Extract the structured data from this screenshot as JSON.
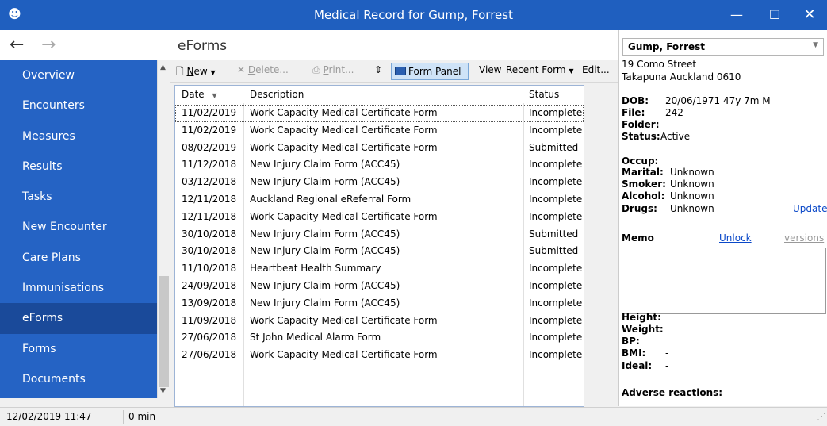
{
  "window": {
    "title": "Medical Record for Gump, Forrest",
    "minimize": "—",
    "maximize": "☐",
    "close": "✕",
    "app_icon": "☻"
  },
  "nav": {
    "back": "←",
    "forward": "→"
  },
  "sidebar": {
    "items": [
      {
        "label": "Overview"
      },
      {
        "label": "Encounters"
      },
      {
        "label": "Measures"
      },
      {
        "label": "Results"
      },
      {
        "label": "Tasks"
      },
      {
        "label": "New Encounter"
      },
      {
        "label": "Care Plans"
      },
      {
        "label": "Immunisations"
      },
      {
        "label": "eForms"
      },
      {
        "label": "Forms"
      },
      {
        "label": "Documents"
      }
    ],
    "active_index": 8
  },
  "page": {
    "title": "eForms"
  },
  "toolbar": {
    "new_u": "N",
    "new_rest": "ew",
    "delete_u": "D",
    "delete_rest": "elete...",
    "print_u": "P",
    "print_rest": "rint...",
    "sync_glyph": "⇕",
    "form_panel": "Form Panel",
    "view": "View",
    "recent": "Recent Form",
    "edit": "Edit..."
  },
  "table": {
    "headers": {
      "date": "Date",
      "description": "Description",
      "status": "Status"
    },
    "rows": [
      {
        "date": "11/02/2019",
        "description": "Work Capacity Medical Certificate Form",
        "status": "Incomplete"
      },
      {
        "date": "11/02/2019",
        "description": "Work Capacity Medical Certificate Form",
        "status": "Incomplete"
      },
      {
        "date": "08/02/2019",
        "description": "Work Capacity Medical Certificate Form",
        "status": "Submitted"
      },
      {
        "date": "11/12/2018",
        "description": "New Injury Claim Form (ACC45)",
        "status": "Incomplete"
      },
      {
        "date": "03/12/2018",
        "description": "New Injury Claim Form (ACC45)",
        "status": "Incomplete"
      },
      {
        "date": "12/11/2018",
        "description": "Auckland Regional eReferral Form",
        "status": "Incomplete"
      },
      {
        "date": "12/11/2018",
        "description": "Work Capacity Medical Certificate Form",
        "status": "Incomplete"
      },
      {
        "date": "30/10/2018",
        "description": "New Injury Claim Form (ACC45)",
        "status": "Submitted"
      },
      {
        "date": "30/10/2018",
        "description": "New Injury Claim Form (ACC45)",
        "status": "Submitted"
      },
      {
        "date": "11/10/2018",
        "description": "Heartbeat Health Summary",
        "status": "Incomplete"
      },
      {
        "date": "24/09/2018",
        "description": "New Injury Claim Form (ACC45)",
        "status": "Incomplete"
      },
      {
        "date": "13/09/2018",
        "description": "New Injury Claim Form (ACC45)",
        "status": "Incomplete"
      },
      {
        "date": "11/09/2018",
        "description": "Work Capacity Medical Certificate Form",
        "status": "Incomplete"
      },
      {
        "date": "27/06/2018",
        "description": "St John Medical Alarm Form",
        "status": "Incomplete"
      },
      {
        "date": "27/06/2018",
        "description": "Work Capacity Medical Certificate Form",
        "status": "Incomplete"
      }
    ]
  },
  "patient": {
    "name": "Gump, Forrest",
    "address1": "19 Como Street",
    "address2": "Takapuna Auckland 0610",
    "dob_label": "DOB:",
    "dob": "20/06/1971 47y 7m M",
    "file_label": "File:",
    "file": "242",
    "folder_label": "Folder:",
    "status_label": "Status:",
    "status": "Active",
    "occup_label": "Occup:",
    "marital_label": "Marital:",
    "marital": "Unknown",
    "smoker_label": "Smoker:",
    "smoker": "Unknown",
    "alcohol_label": "Alcohol:",
    "alcohol": "Unknown",
    "drugs_label": "Drugs:",
    "drugs": "Unknown",
    "update": "Update",
    "memo_label": "Memo",
    "unlock": "Unlock",
    "versions": "versions",
    "height_label": "Height:",
    "weight_label": "Weight:",
    "bp_label": "BP:",
    "bmi_label": "BMI:",
    "bmi": "-",
    "ideal_label": "Ideal:",
    "ideal": "-",
    "adverse_label": "Adverse reactions:"
  },
  "status": {
    "datetime": "12/02/2019 11:47",
    "duration": "0 min"
  }
}
